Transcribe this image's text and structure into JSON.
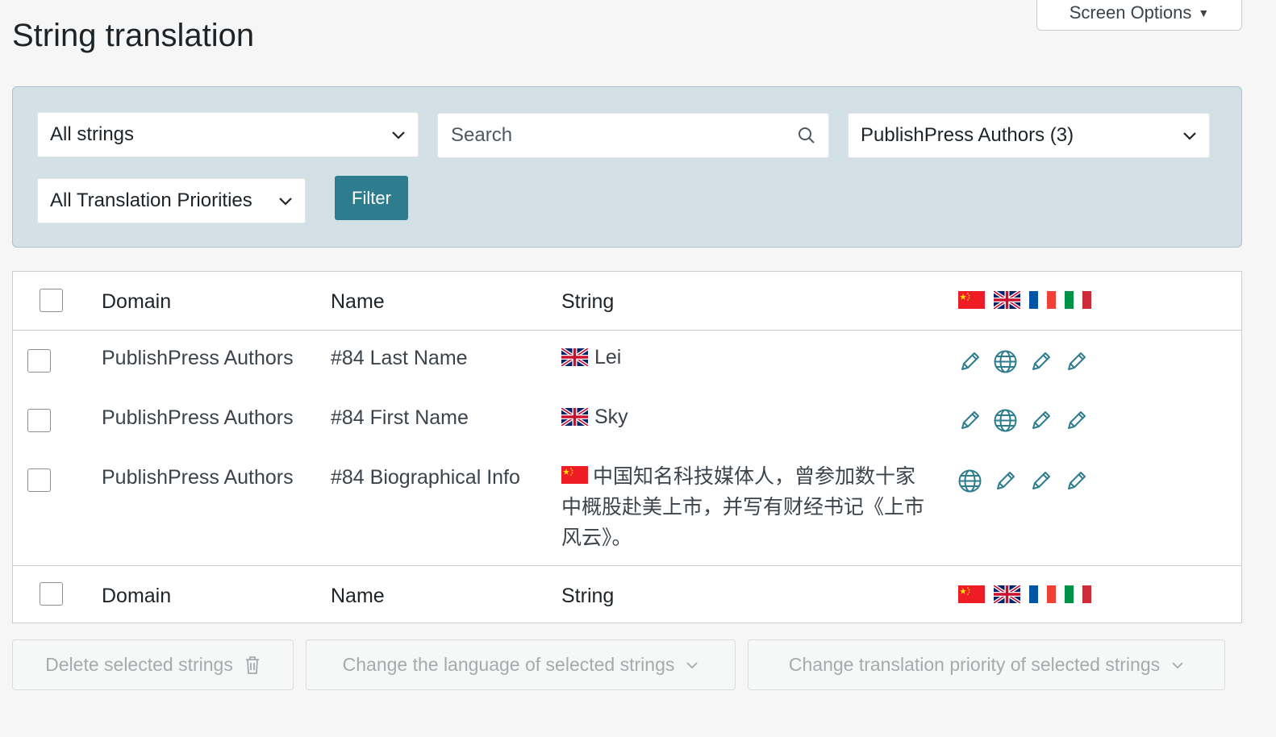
{
  "header": {
    "title": "String translation",
    "screen_options_label": "Screen Options"
  },
  "filters": {
    "strings_select": "All strings",
    "search_placeholder": "Search",
    "domain_select": "PublishPress Authors (3)",
    "priority_select": "All Translation Priorities",
    "filter_button": "Filter"
  },
  "table": {
    "columns": {
      "domain": "Domain",
      "name": "Name",
      "string": "String"
    },
    "language_flags": [
      "flag-china-icon",
      "flag-uk-icon",
      "flag-france-icon",
      "flag-italy-icon"
    ],
    "rows": [
      {
        "domain": "PublishPress Authors",
        "name": "#84 Last Name",
        "string_flag": "flag-uk-icon",
        "string": "Lei",
        "actions": [
          "pencil-icon",
          "globe-icon",
          "pencil-icon",
          "pencil-icon"
        ]
      },
      {
        "domain": "PublishPress Authors",
        "name": "#84 First Name",
        "string_flag": "flag-uk-icon",
        "string": "Sky",
        "actions": [
          "pencil-icon",
          "globe-icon",
          "pencil-icon",
          "pencil-icon"
        ]
      },
      {
        "domain": "PublishPress Authors",
        "name": "#84 Biographical Info",
        "string_flag": "flag-china-icon",
        "string": "中国知名科技媒体人，曾参加数十家中概股赴美上市，并写有财经书记《上市风云》。",
        "actions": [
          "globe-icon",
          "pencil-icon",
          "pencil-icon",
          "pencil-icon"
        ]
      }
    ]
  },
  "bulk_actions": {
    "delete": "Delete selected strings",
    "change_language": "Change the language of selected strings",
    "change_priority": "Change translation priority of selected strings"
  },
  "colors": {
    "filter_panel_bg": "#d3e1e6",
    "filter_button": "#2e7d8f",
    "action_icon": "#2e7d8f"
  }
}
